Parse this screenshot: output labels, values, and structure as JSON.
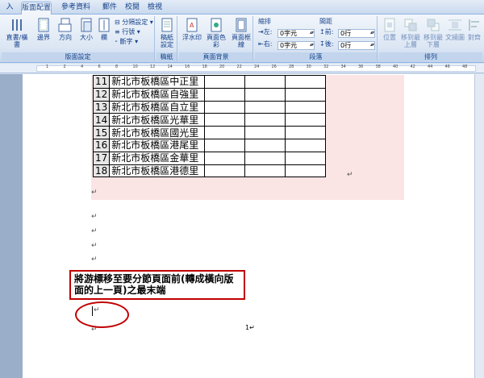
{
  "tabs": [
    "入",
    "版面配置",
    "參考資料",
    "郵件",
    "校閱",
    "檢視"
  ],
  "ribbon": {
    "group_page_setup": {
      "label": "版面設定",
      "buttons": [
        "直書/橫書",
        "邊界",
        "方向",
        "大小",
        "欄"
      ],
      "items": [
        "分隔設定",
        "行號",
        "斷字"
      ]
    },
    "group_manuscript": {
      "label": "稿紙",
      "buttons": [
        "稿紙設定"
      ]
    },
    "group_page_background": {
      "label": "頁面背景",
      "buttons": [
        "浮水印",
        "頁面色彩",
        "頁面框線"
      ]
    },
    "group_paragraph": {
      "label": "段落",
      "indent_title": "縮排",
      "left_label": "左:",
      "left_value": "0字元",
      "right_label": "右:",
      "right_value": "0字元",
      "spacing_title": "間距",
      "before_label": "前:",
      "before_value": "0行",
      "after_label": "後:",
      "after_value": "0行"
    },
    "group_arrange": {
      "label": "排列",
      "buttons": [
        "位置",
        "移到最上層",
        "移到最下層",
        "文繞圖",
        "對齊"
      ]
    }
  },
  "ruler": {
    "numbers": [
      "1",
      "2",
      "4",
      "6",
      "8",
      "10",
      "12",
      "14",
      "16",
      "18",
      "20",
      "22",
      "24",
      "26",
      "28",
      "30",
      "32",
      "34",
      "36",
      "38",
      "40",
      "42",
      "44",
      "46",
      "48"
    ]
  },
  "table": {
    "rows": [
      {
        "num": "11",
        "name": "新北市板橋區中正里"
      },
      {
        "num": "12",
        "name": "新北市板橋區自強里"
      },
      {
        "num": "13",
        "name": "新北市板橋區自立里"
      },
      {
        "num": "14",
        "name": "新北市板橋區光華里"
      },
      {
        "num": "15",
        "name": "新北市板橋區國光里"
      },
      {
        "num": "16",
        "name": "新北市板橋區港尾里"
      },
      {
        "num": "17",
        "name": "新北市板橋區金華里"
      },
      {
        "num": "18",
        "name": "新北市板橋區港德里"
      }
    ]
  },
  "marks": {
    "para": "↵",
    "page_number": "1"
  },
  "callout": {
    "text": "將游標移至要分節頁面前(轉成橫向版面的上一頁)之最末端"
  },
  "colors": {
    "accent": "#c00000",
    "ribbon_text": "#15428b",
    "shade": "#fbe4e4"
  }
}
